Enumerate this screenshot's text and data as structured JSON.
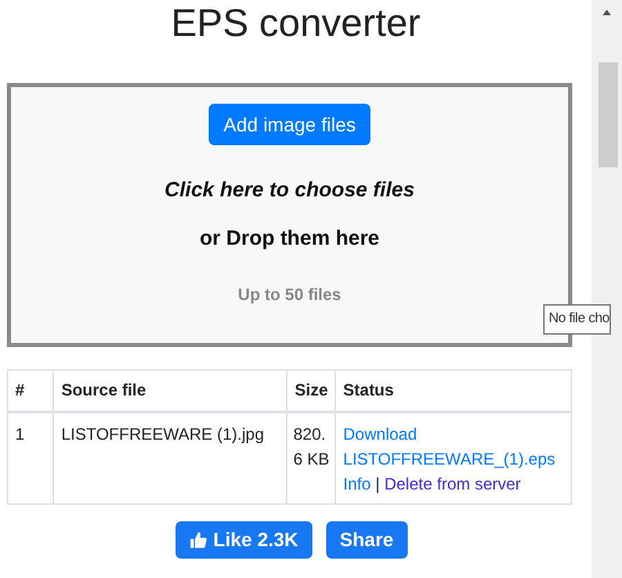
{
  "title": "EPS converter",
  "dropzone": {
    "button": "Add image files",
    "prompt": "Click here to choose files",
    "drop_text": "or Drop them here",
    "limit": "Up to 50 files"
  },
  "tooltip": "No file cho",
  "table": {
    "columns": [
      "#",
      "Source file",
      "Size",
      "Status"
    ],
    "rows": [
      {
        "index": "1",
        "source": "LISTOFFREEWARE (1).jpg",
        "size": "820. 6 KB",
        "links": [
          {
            "text": "Download LISTOFFREEWARE_(1).eps",
            "visited": false
          },
          {
            "text": "Info",
            "visited": false
          },
          {
            "text": "Delete from server",
            "visited": true
          }
        ],
        "separator": "|"
      }
    ]
  },
  "social": [
    {
      "kind": "like",
      "label": "Like 2.3K"
    },
    {
      "kind": "share",
      "label": "Share"
    }
  ]
}
